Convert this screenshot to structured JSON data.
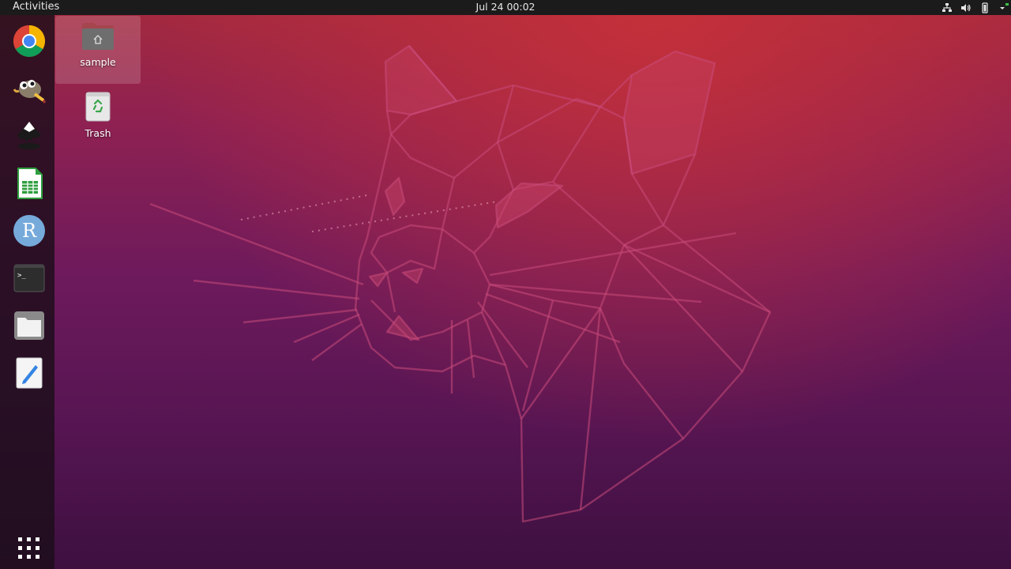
{
  "topbar": {
    "activities_label": "Activities",
    "clock": "Jul 24  00:02",
    "tray_icons": [
      "network-icon",
      "volume-icon",
      "battery-icon",
      "system-menu-icon"
    ]
  },
  "dock": {
    "items": [
      {
        "name": "chrome",
        "icon": "chrome-icon"
      },
      {
        "name": "gimp",
        "icon": "gimp-icon"
      },
      {
        "name": "inkscape",
        "icon": "inkscape-icon"
      },
      {
        "name": "libreoffice-calc",
        "icon": "spreadsheet-icon"
      },
      {
        "name": "rstudio",
        "icon": "r-icon",
        "letter": "R"
      },
      {
        "name": "terminal",
        "icon": "terminal-icon",
        "prompt": ">_"
      },
      {
        "name": "files",
        "icon": "folder-icon"
      },
      {
        "name": "text-editor",
        "icon": "text-editor-icon"
      }
    ],
    "show_apps": {
      "icon": "app-grid-icon"
    }
  },
  "desktop": {
    "icons": [
      {
        "label": "sample",
        "icon": "home-folder-icon",
        "selected": true
      },
      {
        "label": "Trash",
        "icon": "trash-icon",
        "selected": false
      }
    ]
  },
  "colors": {
    "topbar_bg": "#1b1b1b",
    "dock_bg": "#1c0e1a",
    "wallpaper_top": "#a52a3d",
    "wallpaper_bottom": "#3d1040",
    "art_stroke": "#c84b7a"
  }
}
